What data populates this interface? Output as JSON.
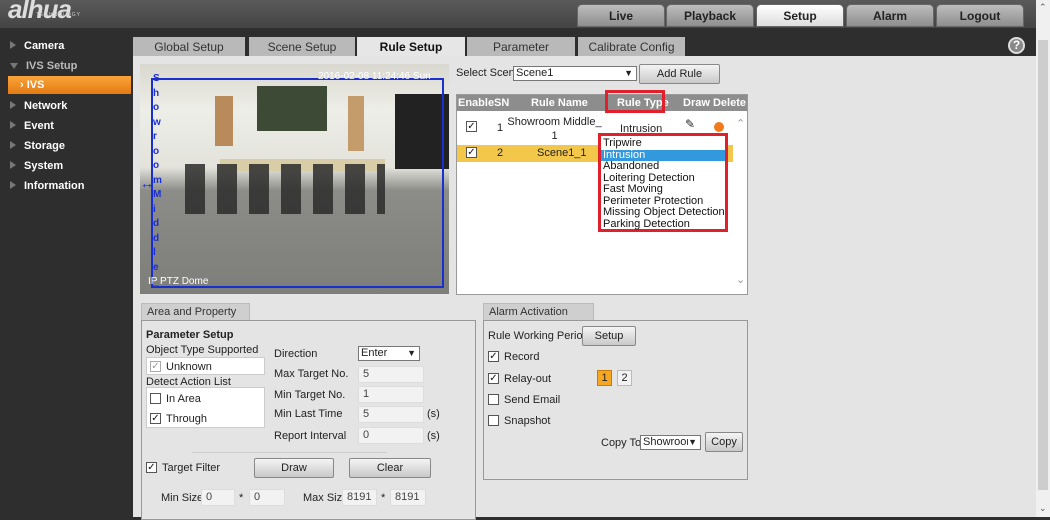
{
  "brand": {
    "logo": "alhua",
    "tagline": "TECHNOLOGY"
  },
  "nav": {
    "tabs": [
      {
        "label": "Live"
      },
      {
        "label": "Playback"
      },
      {
        "label": "Setup",
        "active": true
      },
      {
        "label": "Alarm"
      },
      {
        "label": "Logout"
      }
    ]
  },
  "sidebar": {
    "items": [
      {
        "label": "Camera"
      },
      {
        "label": "IVS Setup",
        "expanded": true
      },
      {
        "label": "IVS",
        "active": true
      },
      {
        "label": "Network"
      },
      {
        "label": "Event"
      },
      {
        "label": "Storage"
      },
      {
        "label": "System"
      },
      {
        "label": "Information"
      }
    ]
  },
  "subtabs": [
    {
      "label": "Global Setup"
    },
    {
      "label": "Scene Setup"
    },
    {
      "label": "Rule Setup",
      "active": true
    },
    {
      "label": "Parameter"
    },
    {
      "label": "Calibrate Config"
    }
  ],
  "help_icon": "question-circle-icon",
  "video": {
    "timestamp": "2016-02-08 11:24:46 Sun",
    "channel": "IP PTZ Dome",
    "rule_label": "ShowroomMiddle_"
  },
  "scene": {
    "label": "Select Scene",
    "value": "Scene1",
    "add_rule": "Add Rule"
  },
  "rules_table": {
    "headers": [
      "Enable",
      "SN",
      "Rule Name",
      "Rule Type",
      "Draw Delete"
    ],
    "rows": [
      {
        "enabled": true,
        "sn": "1",
        "name": "Showroom Middle_ 1",
        "type": "Intrusion"
      },
      {
        "enabled": true,
        "sn": "2",
        "name": "Scene1_1",
        "type": "",
        "selected": true
      }
    ]
  },
  "rule_type_dropdown": {
    "options": [
      "Tripwire",
      "Intrusion",
      "Abandoned",
      "Loitering Detection",
      "Fast Moving",
      "Perimeter Protection",
      "Missing Object Detection",
      "Parking Detection"
    ],
    "highlighted": "Intrusion"
  },
  "colors": {
    "highlight_red": "#e0202a",
    "selected_row": "#f3c84a",
    "accent_orange": "#f08a1e",
    "dropdown_selected": "#3399dd"
  },
  "area": {
    "tab": "Area and Property Setup",
    "title": "Parameter Setup",
    "object_type_label": "Object Type Supported",
    "object_types": [
      {
        "label": "Unknown",
        "checked": true,
        "disabled": true
      }
    ],
    "action_label": "Detect Action List",
    "actions": [
      {
        "label": "In Area",
        "checked": false
      },
      {
        "label": "Through",
        "checked": true
      }
    ],
    "direction": {
      "label": "Direction",
      "value": "Enter"
    },
    "max_target": {
      "label": "Max Target No.",
      "value": "5"
    },
    "min_target": {
      "label": "Min Target No.",
      "value": "1"
    },
    "min_last_time": {
      "label": "Min Last Time",
      "value": "5",
      "unit": "(s)"
    },
    "report_interval": {
      "label": "Report Interval",
      "value": "0",
      "unit": "(s)"
    },
    "target_filter": {
      "label": "Target Filter",
      "checked": true
    },
    "draw": "Draw",
    "clear": "Clear",
    "min_size": {
      "label": "Min Size",
      "w": "0",
      "h": "0"
    },
    "max_size": {
      "label": "Max Size",
      "w": "8191",
      "h": "8191"
    },
    "times": "*"
  },
  "alarm": {
    "tab": "Alarm Activation Setup",
    "period_label": "Rule Working Period",
    "setup": "Setup",
    "record": {
      "label": "Record",
      "checked": true
    },
    "relay": {
      "label": "Relay-out",
      "checked": true,
      "channels": [
        {
          "label": "1",
          "active": true
        },
        {
          "label": "2",
          "active": false
        }
      ]
    },
    "email": {
      "label": "Send Email",
      "checked": false
    },
    "snapshot": {
      "label": "Snapshot",
      "checked": false
    },
    "copy_to": {
      "label": "Copy To",
      "value": "Showroor",
      "button": "Copy"
    }
  }
}
